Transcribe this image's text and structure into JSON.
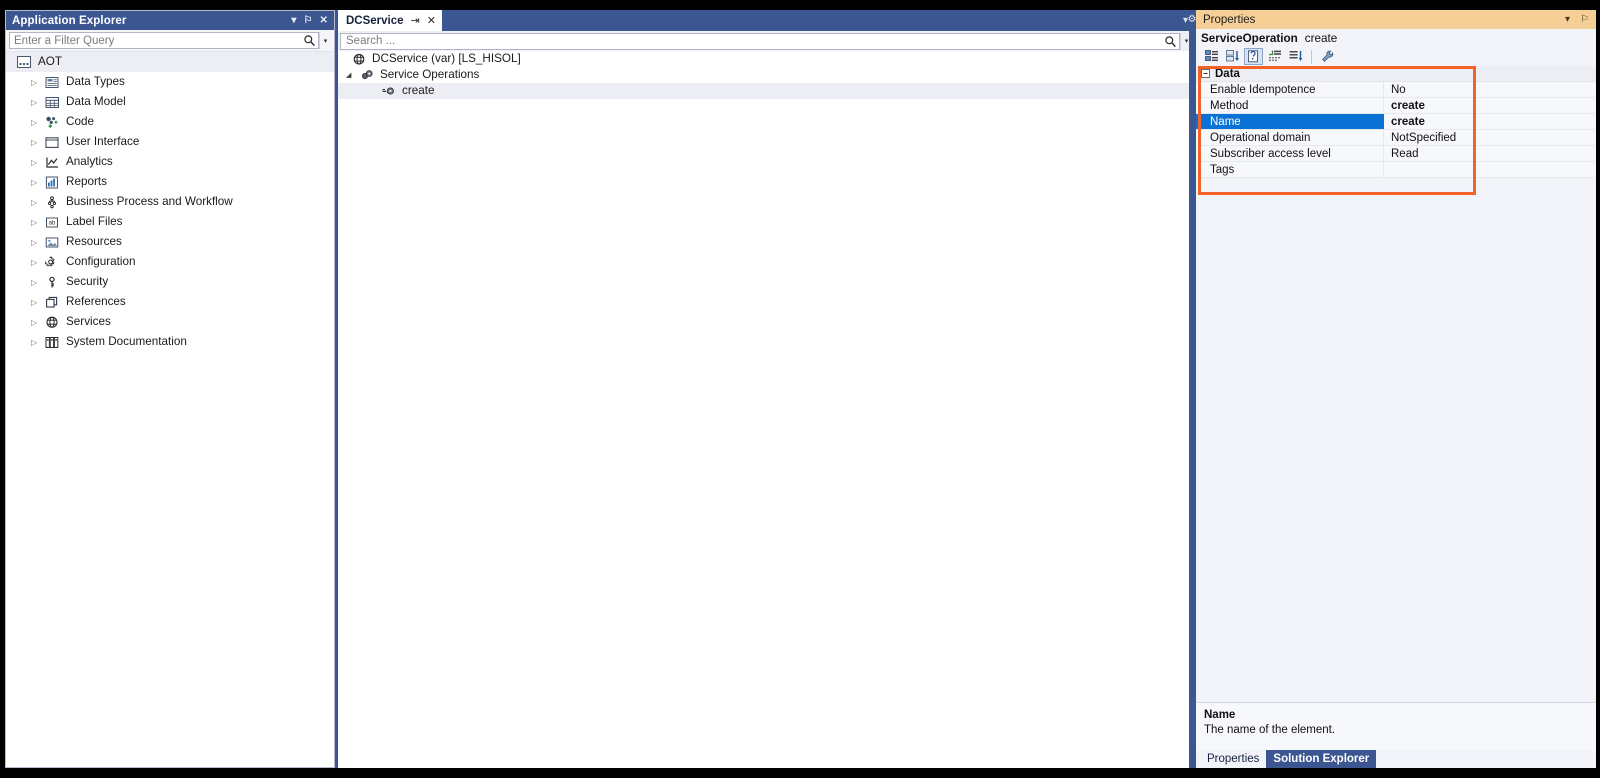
{
  "app_explorer": {
    "title": "Application Explorer",
    "titlebar_buttons": [
      {
        "name": "dropdown-icon",
        "glyph": "▾"
      },
      {
        "name": "pin-icon",
        "glyph": "⚐"
      },
      {
        "name": "close-icon",
        "glyph": "✕"
      }
    ],
    "filter": {
      "placeholder": "Enter a Filter Query",
      "value": "",
      "search_icon": "search-icon",
      "dropdown_glyph": "▾"
    },
    "tree": {
      "root": {
        "label": "AOT",
        "icon": "aot-icon"
      },
      "items": [
        {
          "label": "Data Types",
          "icon": "data-types-icon"
        },
        {
          "label": "Data Model",
          "icon": "data-model-icon"
        },
        {
          "label": "Code",
          "icon": "code-icon"
        },
        {
          "label": "User Interface",
          "icon": "user-interface-icon"
        },
        {
          "label": "Analytics",
          "icon": "analytics-icon"
        },
        {
          "label": "Reports",
          "icon": "reports-icon"
        },
        {
          "label": "Business Process and Workflow",
          "icon": "workflow-icon"
        },
        {
          "label": "Label Files",
          "icon": "label-files-icon"
        },
        {
          "label": "Resources",
          "icon": "resources-icon"
        },
        {
          "label": "Configuration",
          "icon": "configuration-icon"
        },
        {
          "label": "Security",
          "icon": "security-icon"
        },
        {
          "label": "References",
          "icon": "references-icon"
        },
        {
          "label": "Services",
          "icon": "services-icon"
        },
        {
          "label": "System Documentation",
          "icon": "system-documentation-icon"
        }
      ],
      "expander_glyph": "▷"
    }
  },
  "document": {
    "tab": {
      "label": "DCService",
      "pin_glyph": "⇥",
      "close_glyph": "✕"
    },
    "tabstrip_buttons": [
      {
        "name": "tab-list-dropdown-icon",
        "glyph": "▾"
      },
      {
        "name": "designer-gear-icon",
        "glyph": "⚙"
      }
    ],
    "search": {
      "placeholder": "Search ...",
      "value": "",
      "search_icon": "search-icon",
      "dropdown_glyph": "▾"
    },
    "tree": [
      {
        "label": "DCService (var) [LS_HISOL]",
        "icon": "service-globe-icon",
        "level": 0,
        "expander": "",
        "selected": false
      },
      {
        "label": "Service Operations",
        "icon": "service-operations-icon",
        "level": 1,
        "expander": "◢",
        "selected": false
      },
      {
        "label": "create",
        "icon": "service-operation-icon",
        "level": 2,
        "expander": "",
        "selected": true
      }
    ]
  },
  "properties": {
    "title": "Properties",
    "titlebar_buttons": [
      {
        "name": "dropdown-icon",
        "glyph": "▾"
      },
      {
        "name": "pin-icon",
        "glyph": "⚐"
      }
    ],
    "object": {
      "type": "ServiceOperation",
      "name": "create"
    },
    "toolbar": [
      {
        "name": "categorized-button",
        "icon": "categorized-icon",
        "active": false
      },
      {
        "name": "alphabetical-button",
        "icon": "alphabetical-sort-icon",
        "active": false
      },
      {
        "name": "properties-button",
        "icon": "properties-page-icon",
        "active": true
      },
      {
        "name": "events-button",
        "icon": "events-icon",
        "active": false
      },
      {
        "name": "property-pages-button",
        "icon": "property-pages-icon",
        "active": false
      },
      {
        "name": "tools-button",
        "icon": "wrench-icon",
        "active": false
      }
    ],
    "category": {
      "label": "Data",
      "expander_glyph": "−"
    },
    "rows": [
      {
        "name": "Enable Idempotence",
        "value": "No",
        "bold": false,
        "selected": false
      },
      {
        "name": "Method",
        "value": "create",
        "bold": true,
        "selected": false
      },
      {
        "name": "Name",
        "value": "create",
        "bold": true,
        "selected": true
      },
      {
        "name": "Operational domain",
        "value": "NotSpecified",
        "bold": false,
        "selected": false
      },
      {
        "name": "Subscriber access level",
        "value": "Read",
        "bold": false,
        "selected": false
      },
      {
        "name": "Tags",
        "value": "",
        "bold": false,
        "selected": false
      }
    ],
    "description": {
      "title": "Name",
      "text": "The name of the element."
    },
    "bottom_tabs": [
      {
        "label": "Properties",
        "active": false
      },
      {
        "label": "Solution Explorer",
        "active": true
      }
    ]
  },
  "annotation": {
    "highlight_color": "#f4622a",
    "name": "properties-grid-highlight"
  }
}
